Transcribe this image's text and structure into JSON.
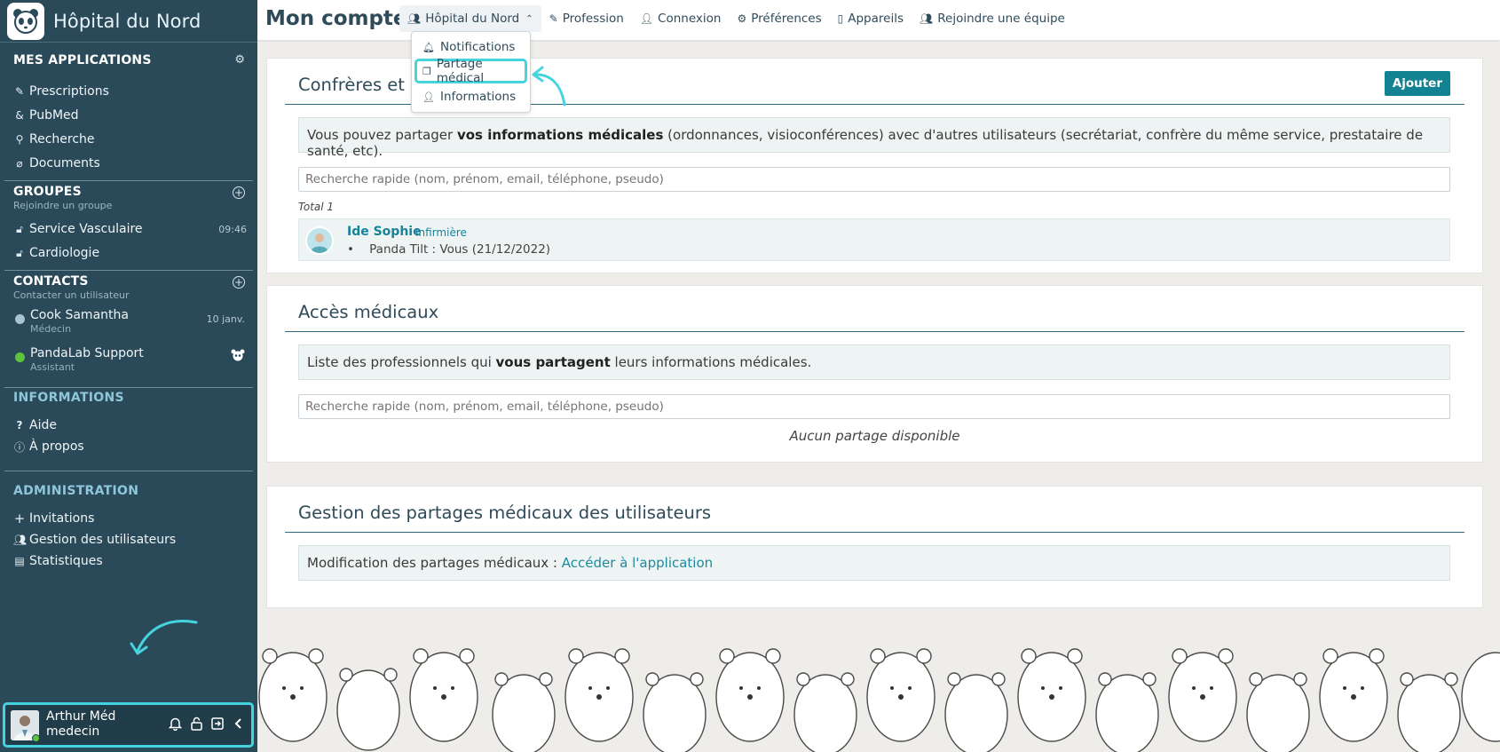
{
  "sidebar": {
    "brand": "Hôpital du Nord",
    "apps": {
      "title": "MES APPLICATIONS",
      "items": [
        {
          "label": "Prescriptions",
          "icon": "prescription-icon"
        },
        {
          "label": "PubMed",
          "icon": "pubmed-icon"
        },
        {
          "label": "Recherche",
          "icon": "search-icon"
        },
        {
          "label": "Documents",
          "icon": "paperclip-icon"
        }
      ]
    },
    "groups": {
      "title": "GROUPES",
      "subtitle": "Rejoindre un groupe",
      "items": [
        {
          "label": "Service Vasculaire",
          "meta": "09:46",
          "icon": "lock-icon"
        },
        {
          "label": "Cardiologie",
          "meta": "",
          "icon": "lock-icon"
        }
      ]
    },
    "contacts": {
      "title": "CONTACTS",
      "subtitle": "Contacter un utilisateur",
      "items": [
        {
          "name": "Cook Samantha",
          "role": "Médecin",
          "meta": "10 janv.",
          "status_color": "#a9c4d0"
        },
        {
          "name": "PandaLab Support",
          "role": "Assistant",
          "meta": "",
          "status_color": "#5cc43d"
        }
      ]
    },
    "informations": {
      "title": "INFORMATIONS",
      "items": [
        {
          "label": "Aide",
          "icon": "question-icon"
        },
        {
          "label": "À propos",
          "icon": "info-icon"
        }
      ]
    },
    "administration": {
      "title": "ADMINISTRATION",
      "items": [
        {
          "label": "Invitations",
          "icon": "plus-icon"
        },
        {
          "label": "Gestion des utilisateurs",
          "icon": "users-icon"
        },
        {
          "label": "Statistiques",
          "icon": "stats-icon"
        }
      ]
    },
    "user": {
      "name": "Arthur Méd",
      "role": "medecin"
    }
  },
  "topbar": {
    "title": "Mon compte",
    "nav": [
      {
        "label": "Hôpital du Nord",
        "icon": "users-icon",
        "active": true
      },
      {
        "label": "Profession",
        "icon": "profession-icon"
      },
      {
        "label": "Connexion",
        "icon": "user-icon"
      },
      {
        "label": "Préférences",
        "icon": "gear-icon"
      },
      {
        "label": "Appareils",
        "icon": "phone-icon"
      },
      {
        "label": "Rejoindre une équipe",
        "icon": "team-icon"
      }
    ],
    "dropdown": [
      {
        "label": "Notifications",
        "icon": "bell-icon"
      },
      {
        "label": "Partage médical",
        "icon": "copy-icon",
        "highlighted": true
      },
      {
        "label": "Informations",
        "icon": "user-icon"
      }
    ]
  },
  "confreres": {
    "title": "Confrères et se",
    "add_label": "Ajouter",
    "info_pre": "Vous pouvez partager ",
    "info_bold": "vos informations médicales",
    "info_post": " (ordonnances, visioconférences) avec d'autres utilisateurs (secrétariat, confrère du même service, prestataire de santé, etc).",
    "search_placeholder": "Recherche rapide (nom, prénom, email, téléphone, pseudo)",
    "total": "Total 1",
    "user": {
      "name": "Ide Sophie",
      "role": "Infirmière",
      "detail": "Panda Tilt : Vous (21/12/2022)"
    }
  },
  "acces": {
    "title": "Accès médicaux",
    "info_pre": "Liste des professionnels qui ",
    "info_bold": "vous partagent",
    "info_post": " leurs informations médicales.",
    "search_placeholder": "Recherche rapide (nom, prénom, email, téléphone, pseudo)",
    "empty": "Aucun partage disponible"
  },
  "gestion": {
    "title": "Gestion des partages médicaux des utilisateurs",
    "info_pre": "Modification des partages médicaux : ",
    "link": "Accéder à l'application"
  },
  "colors": {
    "sidebar": "#2a4a5a",
    "accent": "#138393",
    "highlight": "#45d4df"
  }
}
